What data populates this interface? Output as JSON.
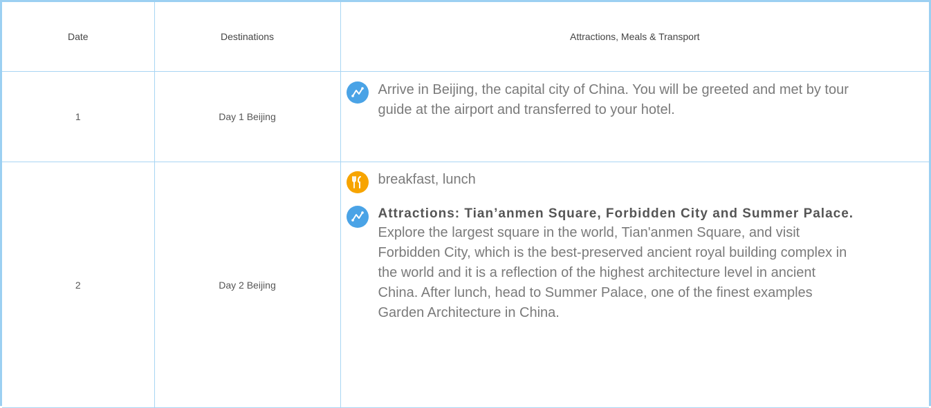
{
  "table": {
    "headers": {
      "date": "Date",
      "destinations": "Destinations",
      "details": "Attractions, Meals & Transport"
    },
    "rows": [
      {
        "date": "1",
        "destination": "Day 1 Beijing",
        "items": [
          {
            "icon": "route-icon",
            "text": "Arrive in Beijing, the capital city of China. You will be greeted and met by tour guide at the airport and transferred to your hotel."
          }
        ]
      },
      {
        "date": "2",
        "destination": "Day 2 Beijing",
        "items": [
          {
            "icon": "meal-icon",
            "text": "breakfast, lunch"
          },
          {
            "icon": "route-icon",
            "title": "Attractions: Tian’anmen Square, Forbidden City and Summer Palace.",
            "text": "Explore the largest square in the world, Tian'anmen Square, and visit Forbidden City, which is the best-preserved ancient royal building complex in the world and it is a reflection of the highest architecture level in ancient China. After lunch, head to Summer Palace, one of the finest examples Garden Architecture in China."
          }
        ]
      }
    ]
  },
  "colors": {
    "border": "#9cd0f2",
    "route_icon": "#4aa3e6",
    "meal_icon": "#f7a400",
    "text": "#7a7a7a"
  }
}
